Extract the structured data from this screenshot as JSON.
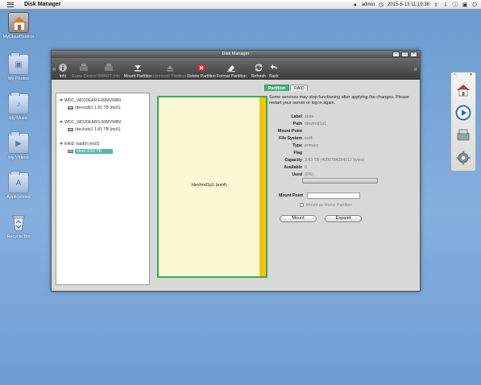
{
  "topbar": {
    "title": "Disk Manager",
    "user": "admin",
    "datetime": "2015-5-13 11:19:36",
    "menu_icon": "hamburger-icon"
  },
  "desktop": {
    "icons": [
      {
        "label": "MyCloudStation",
        "icon": "home-icon"
      },
      {
        "label": "My Photos",
        "icon": "folder-photos-icon"
      },
      {
        "label": "My Music",
        "icon": "folder-music-icon"
      },
      {
        "label": "My Videos",
        "icon": "folder-videos-icon"
      },
      {
        "label": "Applications",
        "icon": "folder-apps-icon"
      },
      {
        "label": "Recycle Bin",
        "icon": "recycle-bin-icon"
      }
    ]
  },
  "window": {
    "title": "Disk Manager",
    "toolbar": [
      {
        "label": "Info",
        "enabled": true
      },
      {
        "label": "Erase Device",
        "enabled": false
      },
      {
        "label": "SMART Info",
        "enabled": false
      },
      {
        "label": "Mount Partition",
        "enabled": true
      },
      {
        "label": "Unmount Partition",
        "enabled": false
      },
      {
        "label": "Delete Partition",
        "enabled": true
      },
      {
        "label": "Format Partition",
        "enabled": true
      },
      {
        "label": "Refresh",
        "enabled": true
      },
      {
        "label": "Back",
        "enabled": true
      }
    ],
    "tree": {
      "devices": [
        {
          "name": "WDC_WD20EARS-00MVWB0",
          "child": "/dev/sdb1 1.81 TB [md1]"
        },
        {
          "name": "WDC_WD20EARS-00MVWB0",
          "child": "/dev/sda1 1.81 TB [md1]"
        },
        {
          "name": "RAID (raid0) [md1]",
          "child": "store 3.63 TB"
        }
      ]
    },
    "tabs": [
      "Partition",
      "RAID"
    ],
    "partition_map_label": "/dev/md1p1 (ext4)",
    "warning": "Some services may stop functioning after applying the changes. Please restart your server or log in again.",
    "details": {
      "label_k": "Label",
      "label_v": "store",
      "path_k": "Path",
      "path_v": "/dev/md1p1",
      "mountpoint_k": "Mount Point",
      "mountpoint_v": "",
      "fs_k": "File System",
      "fs_v": "ext4",
      "type_k": "Type",
      "type_v": "primary",
      "flag_k": "Flag",
      "flag_v": "",
      "capacity_k": "Capacity",
      "capacity_v": "3.63 TB (4000784384512 bytes)",
      "available_k": "Available",
      "available_v": "0",
      "used_k": "Used",
      "used_v": "(0%)"
    },
    "form": {
      "mount_point_label": "Mount Point",
      "mount_point_value": "",
      "home_partition_label": "Mount as Home Partition",
      "mount_button": "Mount",
      "expand_button": "Expand"
    }
  },
  "dock": {
    "items": [
      "home-icon",
      "media-player-icon",
      "storage-drive-icon",
      "settings-gear-icon"
    ]
  }
}
